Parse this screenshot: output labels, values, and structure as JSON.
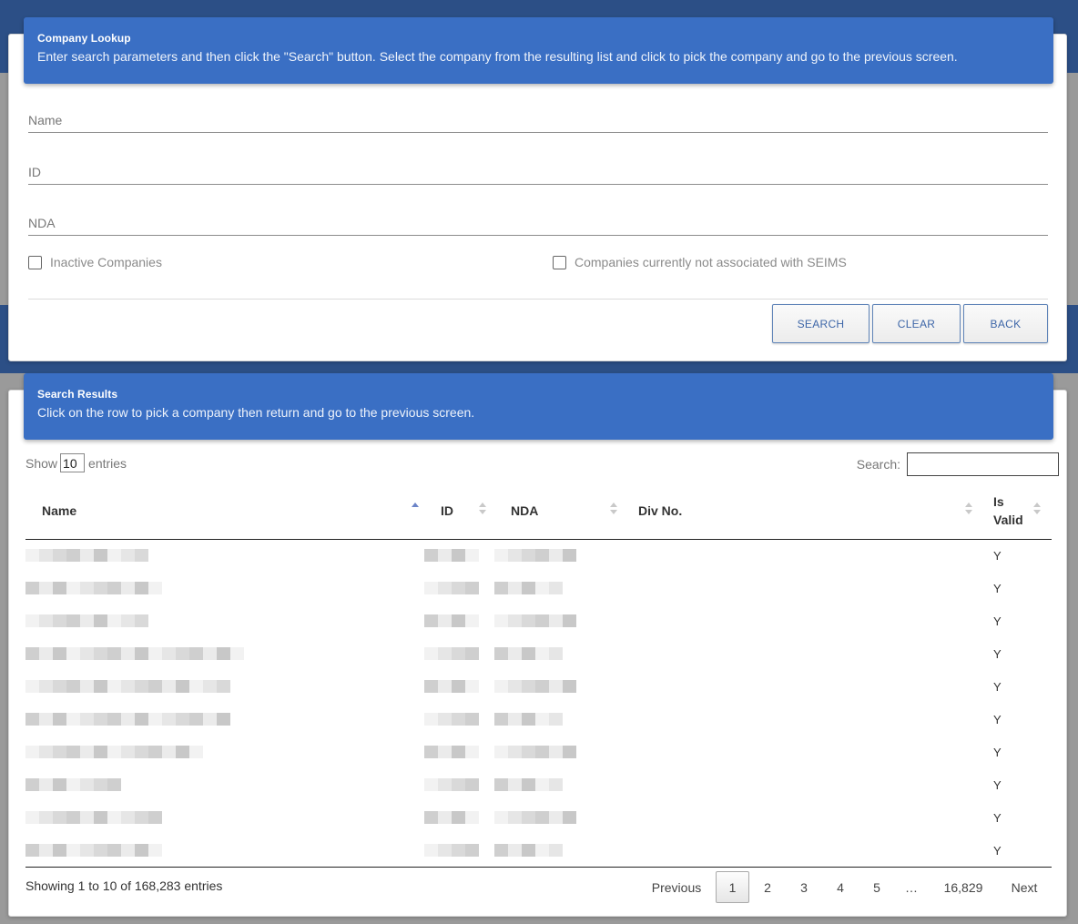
{
  "lookup": {
    "title": "Company Lookup",
    "description": "Enter search parameters and then click the \"Search\" button. Select the company from the resulting list and click to pick the company and go to the previous screen.",
    "name_placeholder": "Name",
    "id_placeholder": "ID",
    "nda_placeholder": "NDA",
    "inactive_label": "Inactive Companies",
    "not_associated_label": "Companies currently not associated with SEIMS",
    "search_button": "SEARCH",
    "clear_button": "CLEAR",
    "back_button": "BACK"
  },
  "results": {
    "title": "Search Results",
    "description": "Click on the row to pick a company then return and go to the previous screen.",
    "show_label": "Show",
    "entries_value": "10",
    "entries_label": "entries",
    "search_label": "Search:",
    "columns": [
      "Name",
      "ID",
      "NDA",
      "Div No.",
      "Is Valid"
    ],
    "rows": [
      {
        "valid": "Y"
      },
      {
        "valid": "Y"
      },
      {
        "valid": "Y"
      },
      {
        "valid": "Y"
      },
      {
        "valid": "Y"
      },
      {
        "valid": "Y"
      },
      {
        "valid": "Y"
      },
      {
        "valid": "Y"
      },
      {
        "valid": "Y"
      },
      {
        "valid": "Y"
      }
    ],
    "info": "Showing 1 to 10 of 168,283 entries",
    "pagination": {
      "previous": "Previous",
      "pages": [
        "1",
        "2",
        "3",
        "4",
        "5",
        "…",
        "16,829"
      ],
      "next": "Next"
    }
  },
  "colors": {
    "header_blue": "#3a6fc4",
    "button_text": "#3d66a8"
  }
}
